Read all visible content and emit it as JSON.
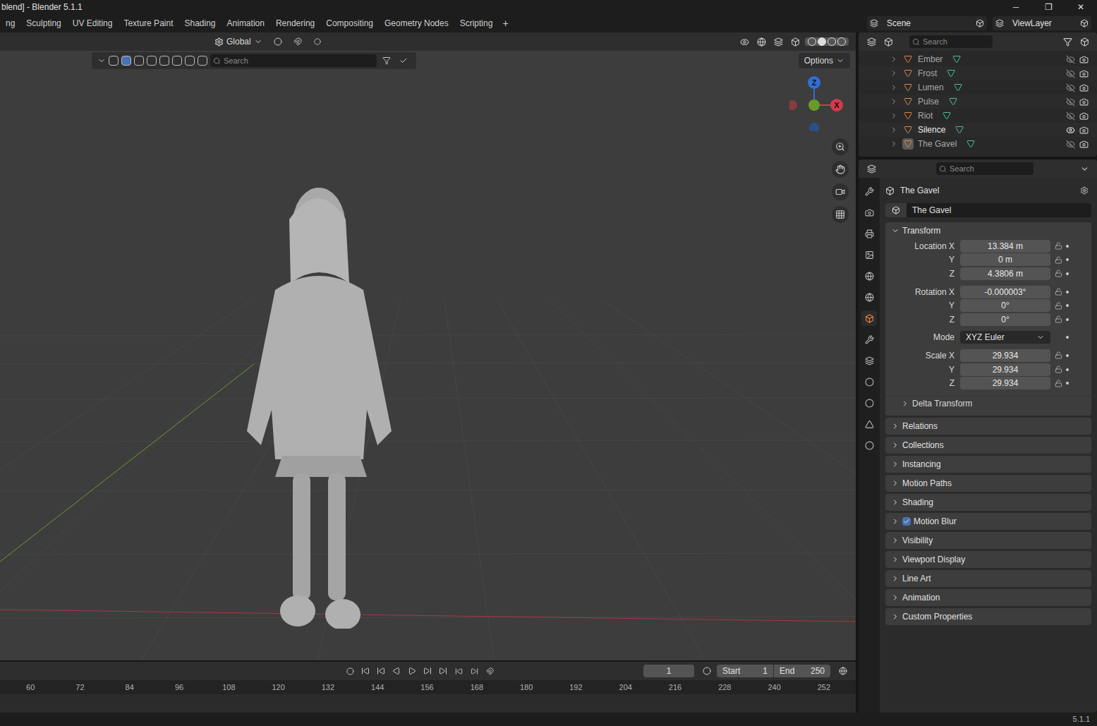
{
  "window": {
    "title": "blend] - Blender 5.1.1",
    "controls": [
      "─",
      "❐",
      "✕"
    ]
  },
  "workspaces": [
    {
      "label": "ng",
      "selected": false
    },
    {
      "label": "Sculpting",
      "selected": false
    },
    {
      "label": "UV Editing",
      "selected": false
    },
    {
      "label": "Texture Paint",
      "selected": false
    },
    {
      "label": "Shading",
      "selected": false
    },
    {
      "label": "Animation",
      "selected": false
    },
    {
      "label": "Rendering",
      "selected": false
    },
    {
      "label": "Compositing",
      "selected": false
    },
    {
      "label": "Geometry Nodes",
      "selected": false
    },
    {
      "label": "Scripting",
      "selected": false
    }
  ],
  "add_workspace": "+",
  "scene": "Scene",
  "view_layer": "ViewLayer",
  "viewport": {
    "orientation": "Global",
    "search_placeholder": "Search",
    "options": "Options",
    "gizmo_axes": [
      "Z",
      "X"
    ]
  },
  "outliner": {
    "search_placeholder": "Search",
    "items": [
      {
        "name": "Ember",
        "visible": false,
        "active": false
      },
      {
        "name": "Frost",
        "visible": false,
        "active": false
      },
      {
        "name": "Lumen",
        "visible": false,
        "active": false
      },
      {
        "name": "Pulse",
        "visible": false,
        "active": false
      },
      {
        "name": "Riot",
        "visible": false,
        "active": false
      },
      {
        "name": "Silence",
        "visible": true,
        "active": false
      },
      {
        "name": "The Gavel",
        "visible": false,
        "active": true
      }
    ]
  },
  "properties": {
    "search_placeholder": "Search",
    "object_name": "The Gavel",
    "datablock": "The Gavel",
    "transform": {
      "title": "Transform",
      "fields": [
        {
          "label": "Location X",
          "value": "13.384 m",
          "kind": "number"
        },
        {
          "label": "Y",
          "value": "0 m",
          "kind": "number"
        },
        {
          "label": "Z",
          "value": "4.3806 m",
          "kind": "number"
        },
        {
          "label": "Rotation X",
          "value": "-0.000003°",
          "kind": "number"
        },
        {
          "label": "Y",
          "value": "0°",
          "kind": "number"
        },
        {
          "label": "Z",
          "value": "0°",
          "kind": "number"
        },
        {
          "label": "Mode",
          "value": "XYZ Euler",
          "kind": "dropdown"
        },
        {
          "label": "Scale X",
          "value": "29.934",
          "kind": "number"
        },
        {
          "label": "Y",
          "value": "29.934",
          "kind": "number"
        },
        {
          "label": "Z",
          "value": "29.934",
          "kind": "number"
        }
      ],
      "subsection": "Delta Transform"
    },
    "panels": [
      {
        "title": "Relations",
        "checkbox": false,
        "checked": false
      },
      {
        "title": "Collections",
        "checkbox": false,
        "checked": false
      },
      {
        "title": "Instancing",
        "checkbox": false,
        "checked": false
      },
      {
        "title": "Motion Paths",
        "checkbox": false,
        "checked": false
      },
      {
        "title": "Shading",
        "checkbox": false,
        "checked": false
      },
      {
        "title": "Motion Blur",
        "checkbox": true,
        "checked": true
      },
      {
        "title": "Visibility",
        "checkbox": false,
        "checked": false
      },
      {
        "title": "Viewport Display",
        "checkbox": false,
        "checked": false
      },
      {
        "title": "Line Art",
        "checkbox": false,
        "checked": false
      },
      {
        "title": "Animation",
        "checkbox": false,
        "checked": false
      },
      {
        "title": "Custom Properties",
        "checkbox": false,
        "checked": false
      }
    ]
  },
  "timeline": {
    "current_frame": "1",
    "start_label": "Start",
    "start": "1",
    "end_label": "End",
    "end": "250",
    "ruler": [
      "60",
      "72",
      "84",
      "96",
      "108",
      "120",
      "132",
      "144",
      "156",
      "168",
      "180",
      "192",
      "204",
      "216",
      "228",
      "240",
      "252"
    ]
  },
  "status_bar": {
    "version": "5.1.1"
  }
}
